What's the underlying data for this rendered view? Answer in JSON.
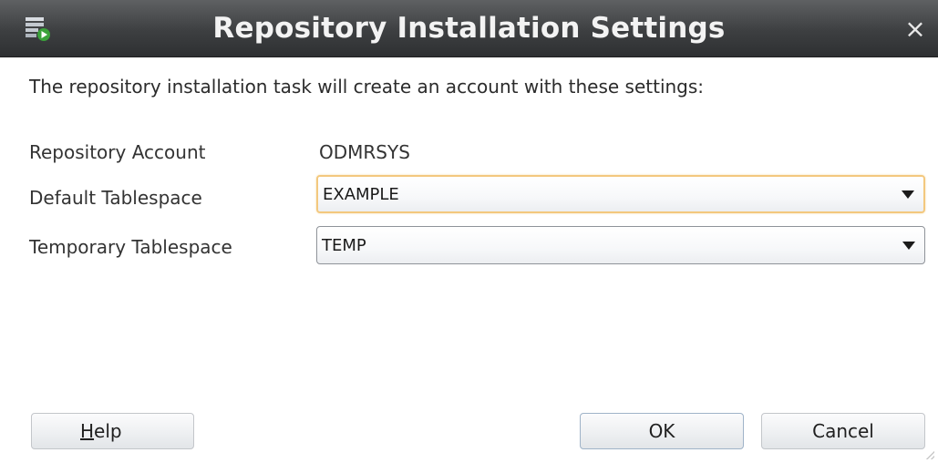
{
  "window": {
    "title": "Repository Installation Settings",
    "close_symbol": "×",
    "icon": "database-run-icon"
  },
  "intro": "The repository installation task will create an account with these settings:",
  "fields": {
    "repository_account": {
      "label": "Repository Account",
      "value": "ODMRSYS"
    },
    "default_tablespace": {
      "label": "Default Tablespace",
      "value": "EXAMPLE"
    },
    "temporary_tablespace": {
      "label": "Temporary Tablespace",
      "value": "TEMP"
    }
  },
  "buttons": {
    "help": {
      "mnemonic": "H",
      "rest": "elp"
    },
    "ok": "OK",
    "cancel": "Cancel"
  },
  "colors": {
    "titlebar": "#3d3f41",
    "title_text": "#f3f3f3",
    "focus_ring": "#f3c87e"
  }
}
